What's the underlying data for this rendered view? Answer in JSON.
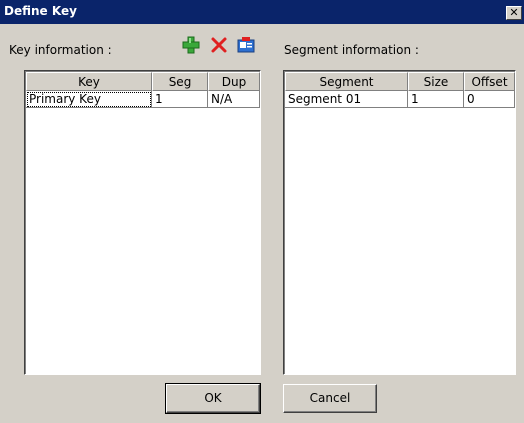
{
  "window": {
    "title": "Define Key",
    "close_glyph": "✕"
  },
  "key_panel": {
    "label": "Key information :",
    "toolbar": [
      {
        "name": "add-key-icon",
        "icon": "green-plus"
      },
      {
        "name": "delete-key-icon",
        "icon": "red-x"
      },
      {
        "name": "properties-key-icon",
        "icon": "card-icon"
      }
    ],
    "columns": [
      "Key",
      "Seg",
      "Dup"
    ],
    "rows": [
      {
        "key": "Primary Key",
        "seg": "1",
        "dup": "N/A"
      }
    ]
  },
  "segment_panel": {
    "label": "Segment information :",
    "columns": [
      "Segment",
      "Size",
      "Offset"
    ],
    "rows": [
      {
        "segment": "Segment 01",
        "size": "1",
        "offset": "0"
      }
    ]
  },
  "buttons": {
    "ok": "OK",
    "cancel": "Cancel"
  },
  "colors": {
    "titlebar": "#0a246a",
    "face": "#d4d0c8",
    "add": "#3aa83a",
    "delete": "#e02020"
  }
}
